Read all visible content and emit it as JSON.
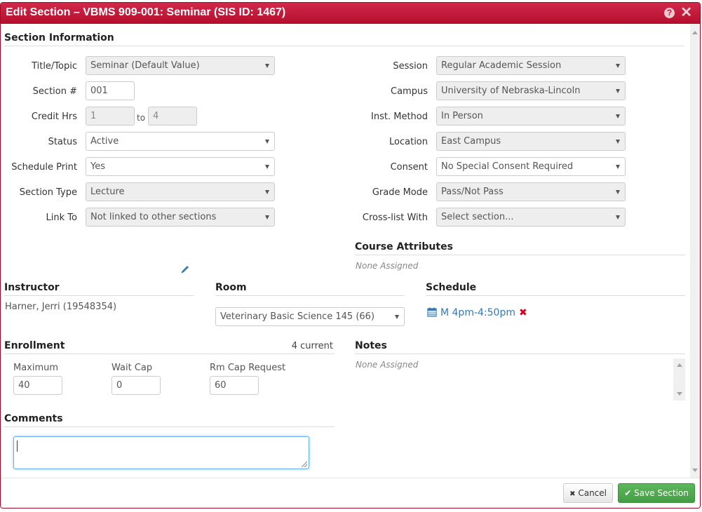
{
  "dialog": {
    "title": "Edit Section – VBMS 909-001: Seminar (SIS ID: 1467)",
    "help_icon": "question-circle-icon",
    "close_icon": "close-icon",
    "help_glyph": "?",
    "close_glyph": "✕"
  },
  "section_information": {
    "heading": "Section Information",
    "left_fields": {
      "title_topic": {
        "label": "Title/Topic",
        "value": "Seminar (Default Value)",
        "disabled": true
      },
      "section_number": {
        "label": "Section #",
        "value": "001"
      },
      "credit_hrs": {
        "label": "Credit Hrs",
        "min": "1",
        "separator": "to",
        "max": "4",
        "disabled": true
      },
      "status": {
        "label": "Status",
        "value": "Active"
      },
      "schedule_print": {
        "label": "Schedule Print",
        "value": "Yes"
      },
      "section_type": {
        "label": "Section Type",
        "value": "Lecture",
        "disabled": true
      },
      "link_to": {
        "label": "Link To",
        "value": "Not linked to other sections",
        "disabled": true
      }
    },
    "right_fields": {
      "session": {
        "label": "Session",
        "value": "Regular Academic Session",
        "disabled": true
      },
      "campus": {
        "label": "Campus",
        "value": "University of Nebraska-Lincoln",
        "disabled": true
      },
      "inst_method": {
        "label": "Inst. Method",
        "value": "In Person",
        "disabled": true
      },
      "location": {
        "label": "Location",
        "value": "East Campus",
        "disabled": true
      },
      "consent": {
        "label": "Consent",
        "value": "No Special Consent Required"
      },
      "grade_mode": {
        "label": "Grade Mode",
        "value": "Pass/Not Pass",
        "disabled": true
      },
      "cross_list": {
        "label": "Cross-list With",
        "value": "Select section...",
        "disabled": true
      }
    }
  },
  "course_attributes": {
    "heading": "Course Attributes",
    "value": "None Assigned"
  },
  "instructor": {
    "heading": "Instructor",
    "name": "Harner, Jerri (19548354)",
    "edit_icon": "pencil-icon"
  },
  "room": {
    "heading": "Room",
    "value": "Veterinary Basic Science 145 (66)"
  },
  "schedule": {
    "heading": "Schedule",
    "meeting": "M 4pm-4:50pm",
    "icon": "calendar-icon",
    "remove_glyph": "✖"
  },
  "enrollment": {
    "heading": "Enrollment",
    "current": "4 current",
    "maximum": {
      "label": "Maximum",
      "value": "40"
    },
    "wait_cap": {
      "label": "Wait Cap",
      "value": "0"
    },
    "rm_cap_request": {
      "label": "Rm Cap Request",
      "value": "60"
    }
  },
  "notes": {
    "heading": "Notes",
    "value": "None Assigned"
  },
  "comments": {
    "heading": "Comments",
    "value": ""
  },
  "footer": {
    "cancel_label": "Cancel",
    "cancel_glyph": "✖",
    "save_label": "Save Section",
    "save_glyph": "✔"
  },
  "colors": {
    "title_bar": "#c11a3a",
    "link": "#337ab7",
    "remove": "#d9001b",
    "save_button": "#5cb85c"
  }
}
